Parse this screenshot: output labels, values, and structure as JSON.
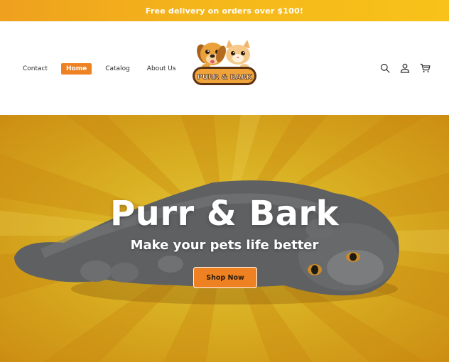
{
  "announcement": {
    "text": "Free delivery on orders over $100!"
  },
  "nav": {
    "items": [
      {
        "label": "Contact"
      },
      {
        "label": "Home",
        "active": true
      },
      {
        "label": "Catalog"
      },
      {
        "label": "About Us"
      }
    ]
  },
  "logo": {
    "text": "PURR & BARK"
  },
  "header_icons": [
    "search-icon",
    "account-icon",
    "cart-icon"
  ],
  "hero": {
    "title": "Purr & Bark",
    "subtitle": "Make your pets life better",
    "cta_label": "Shop Now"
  },
  "colors": {
    "accent": "#ee8222",
    "announce_bar": "#f5b81a",
    "hero_bg": "#d9af22"
  }
}
